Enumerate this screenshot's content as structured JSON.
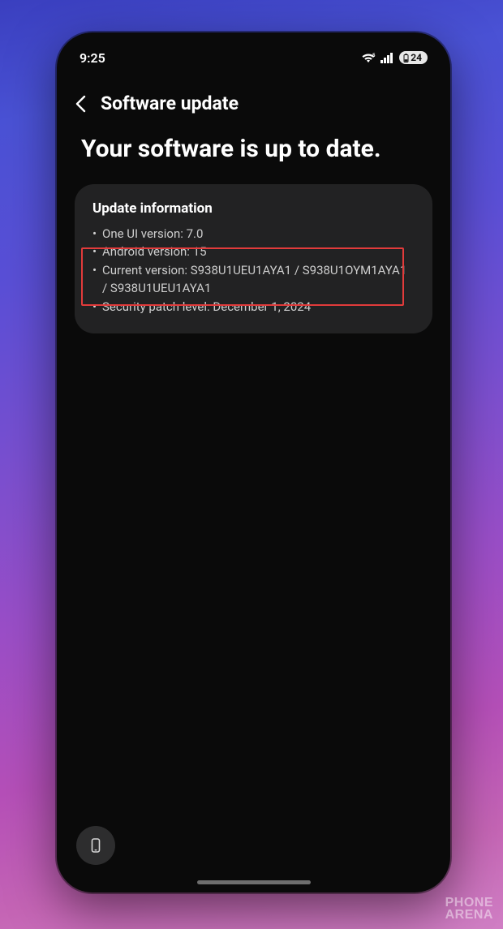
{
  "status_bar": {
    "time": "9:25",
    "battery": "24"
  },
  "header": {
    "title": "Software update"
  },
  "heading": "Your software is up to date.",
  "card": {
    "title": "Update information",
    "items": [
      "One UI version: 7.0",
      "Android version: 15",
      "Current version: S938U1UEU1AYA1 / S938U1OYM1AYA1 / S938U1UEU1AYA1",
      "Security patch level: December 1, 2024"
    ]
  },
  "watermark": {
    "line1": "PHONE",
    "line2": "ARENA"
  }
}
